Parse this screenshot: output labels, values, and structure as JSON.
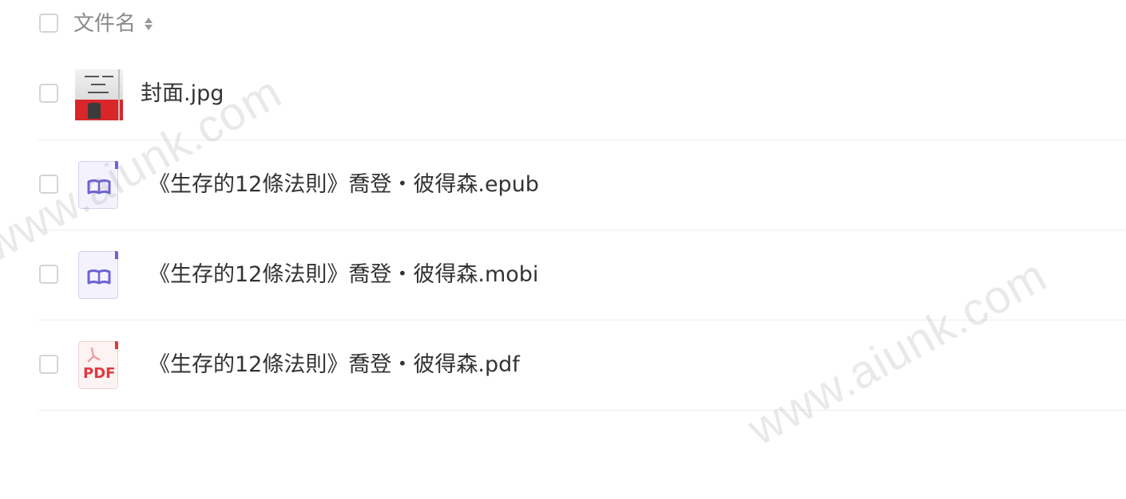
{
  "header": {
    "column_label": "文件名",
    "sort_icon": "sort-icon"
  },
  "files": [
    {
      "name": "封面.jpg",
      "icon": "image-thumbnail"
    },
    {
      "name": "《生存的12條法則》喬登・彼得森.epub",
      "icon": "ebook-icon"
    },
    {
      "name": "《生存的12條法則》喬登・彼得森.mobi",
      "icon": "ebook-icon"
    },
    {
      "name": "《生存的12條法則》喬登・彼得森.pdf",
      "icon": "pdf-icon",
      "icon_text": "PDF"
    }
  ],
  "watermark": "www.aiunk.com",
  "colors": {
    "ebook_icon": "#6c63d6",
    "pdf_icon": "#e0383e",
    "thumbnail_red": "#d8262a"
  }
}
